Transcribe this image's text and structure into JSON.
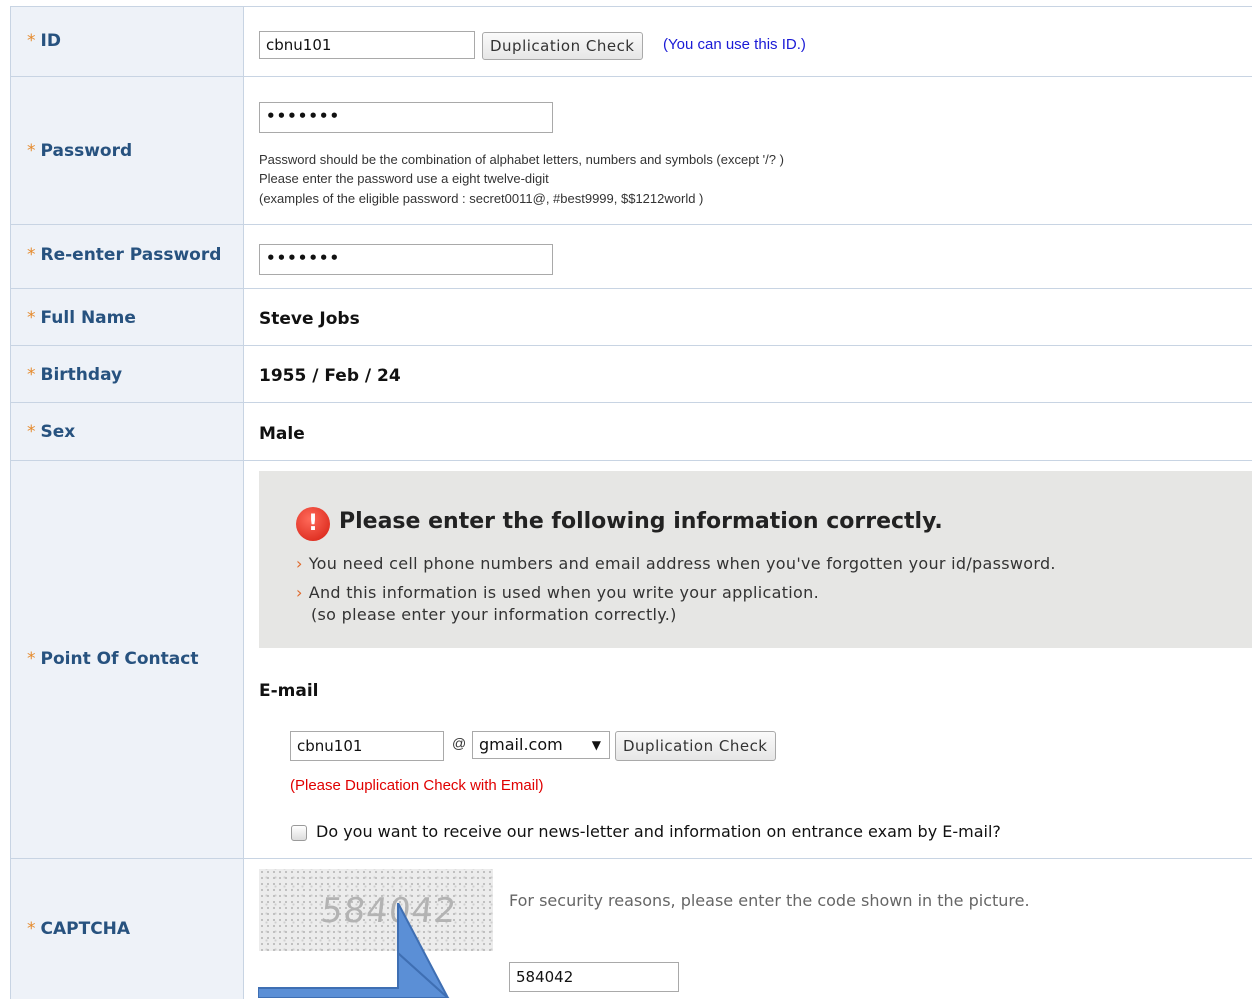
{
  "fields": {
    "id": {
      "label": "ID",
      "value": "cbnu101",
      "check_button": "Duplication Check",
      "status": "(You can use this ID.)"
    },
    "password": {
      "label": "Password",
      "masked_value": "•••••••",
      "notes": [
        "Password should be the combination of alphabet letters, numbers and symbols (except '/? )",
        "Please enter the password use a eight twelve-digit",
        "(examples of the eligible password : secret0011@, #best9999, $$1212world )"
      ]
    },
    "reenter_password": {
      "label": "Re-enter Password",
      "masked_value": "•••••••"
    },
    "full_name": {
      "label": "Full Name",
      "value": "Steve Jobs"
    },
    "birthday": {
      "label": "Birthday",
      "value": "1955 / Feb / 24"
    },
    "sex": {
      "label": "Sex",
      "value": "Male"
    },
    "contact": {
      "label": "Point Of Contact",
      "notice_title": "Please enter the following information correctly.",
      "notice_lines": [
        "You need cell phone numbers and email address when you've forgotten your id/password.",
        "And this information is used when you write your application.",
        "(so please enter your information correctly.)"
      ],
      "email_heading": "E-mail",
      "email_user": "cbnu101",
      "at_sign": "@",
      "email_domain": "gmail.com",
      "check_button": "Duplication Check",
      "email_warning": "(Please Duplication Check with Email)",
      "newsletter_label": "Do you want to receive our news-letter and information on entrance exam by E-mail?",
      "newsletter_checked": false
    },
    "captcha": {
      "label": "CAPTCHA",
      "image_code": "584042",
      "instruction": "For security reasons, please enter the code shown in the picture.",
      "value": "584042"
    }
  },
  "required_marker": "*",
  "colors": {
    "label_bg": "#eef2f8",
    "label_text": "#27527f",
    "asterisk": "#e58a2c",
    "border": "#c8d4e3",
    "ok_text": "#1a1ad6",
    "warn_text": "#e00000",
    "arrow_fill": "#5b8fd6"
  }
}
